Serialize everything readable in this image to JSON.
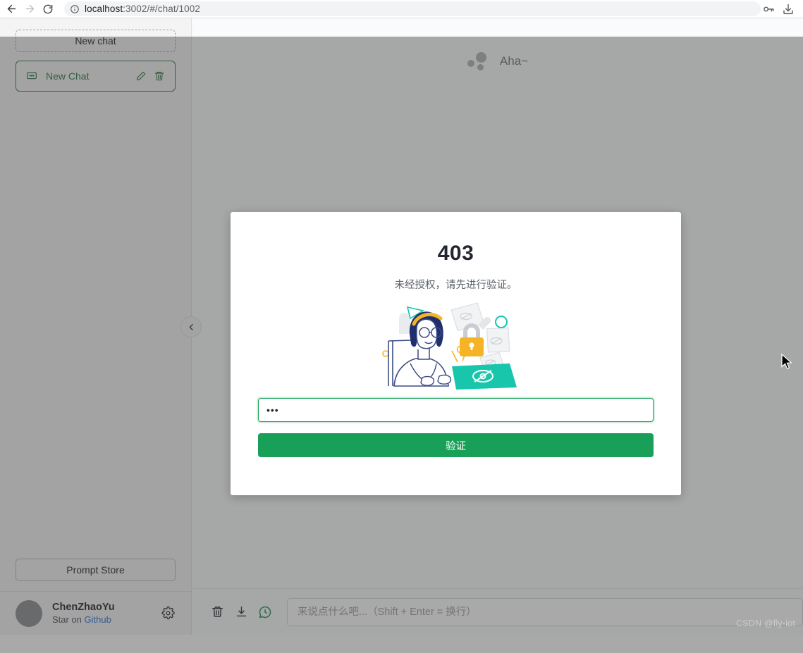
{
  "browser": {
    "back_icon": "arrow-left-icon",
    "forward_icon": "arrow-right-icon",
    "reload_icon": "reload-icon",
    "info_icon": "info-circle-icon",
    "url_host": "localhost",
    "url_path": ":3002/#/chat/1002",
    "url_full": "localhost:3002/#/chat/1002",
    "right_icons": [
      "key-icon",
      "download-icon"
    ]
  },
  "sidebar": {
    "new_chat_label": "New chat",
    "chats": [
      {
        "label": "New Chat",
        "icon": "chat-bubble-icon",
        "edit_icon": "pencil-icon",
        "delete_icon": "trash-icon",
        "active": true
      }
    ],
    "prompt_store_label": "Prompt Store",
    "user_name": "ChenZhaoYu",
    "star_prefix": "Star on ",
    "star_link": "Github",
    "settings_icon": "gear-icon",
    "collapse_icon": "chevron-left-icon"
  },
  "main": {
    "logo_text": "Aha~",
    "composer": {
      "clear_icon": "trash-icon",
      "export_icon": "download-icon",
      "history_icon": "chat-history-icon",
      "input_placeholder": "来说点什么吧...（Shift + Enter = 换行）",
      "input_value": ""
    }
  },
  "modal": {
    "code": "403",
    "description": "未经授权，请先进行验证。",
    "illustration_name": "unauthorized-privacy-illustration",
    "secret_value": "•••",
    "secret_placeholder": "",
    "verify_label": "验证"
  },
  "colors": {
    "brand_green": "#18a058",
    "sidebar_green": "#2f7a46",
    "link_blue": "#2f6fd0",
    "lock_yellow": "#f5b425",
    "teal": "#18c6ac",
    "navy": "#2b3a77",
    "overlay": "rgba(64,64,64,0.45)"
  },
  "watermark": "CSDN @fly-iot"
}
